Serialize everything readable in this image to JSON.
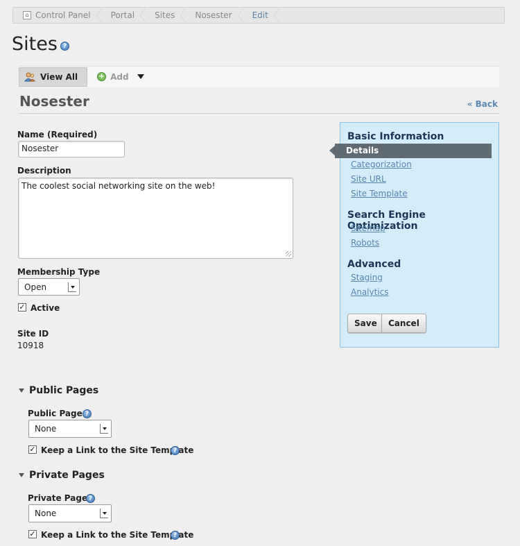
{
  "breadcrumb": [
    "Control Panel",
    "Portal",
    "Sites",
    "Nosester",
    "Edit"
  ],
  "page_title": "Sites",
  "toolbar": {
    "view_all": "View All",
    "add": "Add"
  },
  "site_name": "Nosester",
  "back_link": "« Back",
  "form": {
    "name_label": "Name (Required)",
    "name_value": "Nosester",
    "description_label": "Description",
    "description_value": "The coolest social networking site on the web!",
    "membership_label": "Membership Type",
    "membership_value": "Open",
    "active_label": "Active",
    "site_id_label": "Site ID",
    "site_id_value": "10918"
  },
  "public_pages": {
    "section_title": "Public Pages",
    "field_label": "Public Pages",
    "select_value": "None",
    "keep_link_label": "Keep a Link to the Site Template"
  },
  "private_pages": {
    "section_title": "Private Pages",
    "field_label": "Private Pages",
    "select_value": "None",
    "keep_link_label": "Keep a Link to the Site Template"
  },
  "panel": {
    "basic_heading": "Basic Information",
    "basic_items": [
      "Details",
      "Categorization",
      "Site URL",
      "Site Template"
    ],
    "seo_heading": "Search Engine Optimization",
    "seo_items": [
      "Sitemap",
      "Robots"
    ],
    "advanced_heading": "Advanced",
    "advanced_items": [
      "Staging",
      "Analytics"
    ],
    "save_label": "Save",
    "cancel_label": "Cancel"
  },
  "colors": {
    "panel_bg": "#d4edfb",
    "panel_border": "#8fc3e6",
    "active_item": "#5f6a72",
    "link": "#5784ad"
  }
}
